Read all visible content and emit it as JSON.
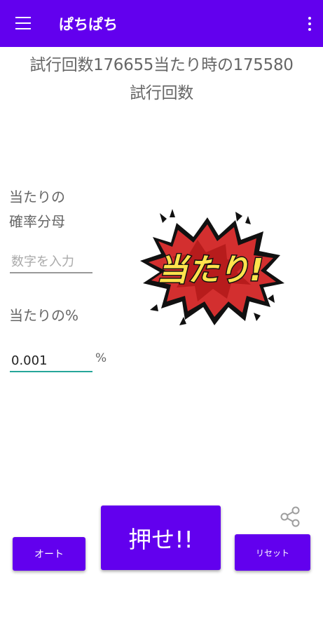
{
  "appbar": {
    "title": "ぱちぱち",
    "menu_icon": "hamburger-menu-icon",
    "overflow_icon": "more-vert-icon",
    "color": "#6200ee"
  },
  "status": {
    "line1": "試行回数176655当たり時の175580",
    "line2": "試行回数"
  },
  "form": {
    "denominator_label_line1": "当たりの",
    "denominator_label_line2": "確率分母",
    "denominator_placeholder": "数字を入力",
    "denominator_value": "",
    "percent_label": "当たりの%",
    "percent_value": "0.001",
    "percent_sign": "%"
  },
  "hit_image": {
    "text": "当たり!",
    "icon": "explosion-burst-icon",
    "colors": {
      "burst": "#d32f2f",
      "text": "#ffe34d",
      "outline": "#111111"
    }
  },
  "buttons": {
    "auto": "オート",
    "push": "押せ!!",
    "reset": "リセット",
    "share_icon": "share-icon",
    "color": "#6200ee"
  }
}
